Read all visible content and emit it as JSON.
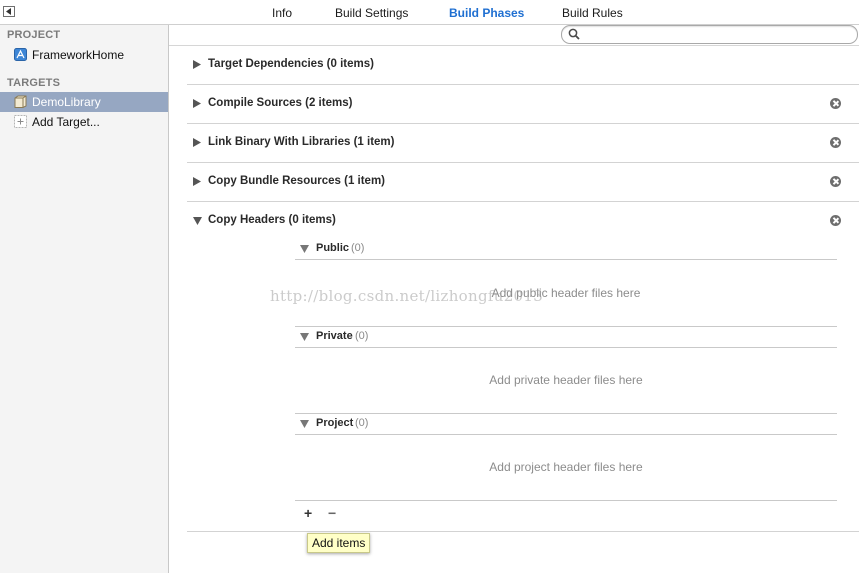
{
  "tabs": [
    "Info",
    "Build Settings",
    "Build Phases",
    "Build Rules"
  ],
  "active_tab": "Build Phases",
  "sidebar": {
    "project_header": "PROJECT",
    "project_item": "FrameworkHome",
    "targets_header": "TARGETS",
    "target_item": "DemoLibrary",
    "add_target": "Add Target..."
  },
  "search": {
    "value": "",
    "placeholder": ""
  },
  "phases": [
    {
      "title": "Target Dependencies (0 items)",
      "removable": false
    },
    {
      "title": "Compile Sources (2 items)",
      "removable": true
    },
    {
      "title": "Link Binary With Libraries (1 item)",
      "removable": true
    },
    {
      "title": "Copy Bundle Resources (1 item)",
      "removable": true
    },
    {
      "title": "Copy Headers (0 items)",
      "removable": true,
      "expanded": true
    }
  ],
  "copy_headers": {
    "public": {
      "name": "Public",
      "count": "(0)",
      "placeholder": "Add public header files here"
    },
    "private": {
      "name": "Private",
      "count": "(0)",
      "placeholder": "Add private header files here"
    },
    "project": {
      "name": "Project",
      "count": "(0)",
      "placeholder": "Add project header files here"
    }
  },
  "controls": {
    "add": "+",
    "remove": "−"
  },
  "tooltip": "Add items",
  "watermark": "http://blog.csdn.net/lizhongfu2013",
  "colors": {
    "accent": "#1f6fd1",
    "selection": "#96a7c2",
    "tooltip": "#ffffc7"
  },
  "icons": {
    "nav_toggle": "navigator-toggle-icon",
    "project": "xcode-project-icon",
    "target": "library-target-icon",
    "add_target": "add-target-icon",
    "search": "search-icon",
    "disclosure": "disclosure-triangle-icon",
    "delete": "remove-phase-icon"
  }
}
